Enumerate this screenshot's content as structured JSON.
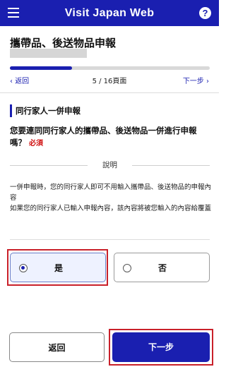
{
  "header": {
    "title": "Visit Japan Web",
    "help_label": "?"
  },
  "page": {
    "title": "攜帶品、後送物品申報"
  },
  "progress": {
    "current": 5,
    "total": 16,
    "fraction": 0.3125
  },
  "nav": {
    "prev_label": "返回",
    "page_label": "5 / 16頁面",
    "next_label": "下一步"
  },
  "section": {
    "title": "同行家人一併申報"
  },
  "question": {
    "text": "您要連同同行家人的攜帶品、後送物品一併進行申報嗎？",
    "required": "必須"
  },
  "explanation": {
    "label": "說明",
    "line1": "一併申報時，您的同行家人即可不用輸入攜帶品、後送物品的申報內容",
    "line2": "如果您的同行家人已輸入申報內容，該內容將被您輸入的內容給覆蓋"
  },
  "options": [
    {
      "label": "是",
      "selected": true
    },
    {
      "label": "否",
      "selected": false
    }
  ],
  "buttons": {
    "back": "返回",
    "next": "下一步"
  },
  "colors": {
    "brand": "#1a1fb0",
    "required": "#d01010",
    "highlight": "#c9202a"
  }
}
